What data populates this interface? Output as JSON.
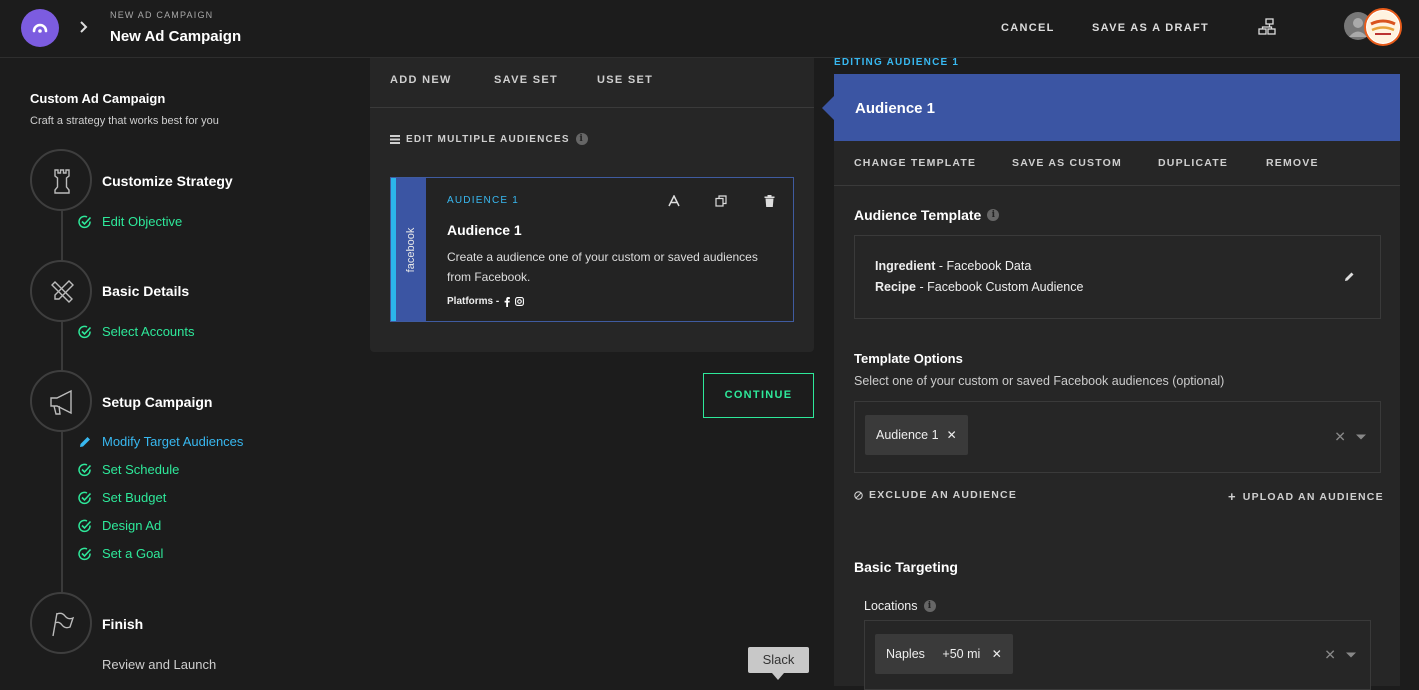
{
  "header": {
    "breadcrumb": "NEW AD CAMPAIGN",
    "title": "New Ad Campaign",
    "cancel_label": "CANCEL",
    "save_draft_label": "SAVE AS A DRAFT"
  },
  "sidebar": {
    "title": "Custom Ad Campaign",
    "subtitle": "Craft a strategy that works best for you",
    "steps": [
      {
        "title": "Customize Strategy",
        "icon": "rook-icon",
        "items": [
          {
            "label": "Edit Objective",
            "status": "done"
          }
        ]
      },
      {
        "title": "Basic Details",
        "icon": "tools-icon",
        "items": [
          {
            "label": "Select Accounts",
            "status": "done"
          }
        ]
      },
      {
        "title": "Setup Campaign",
        "icon": "megaphone-icon",
        "items": [
          {
            "label": "Modify Target Audiences",
            "status": "active"
          },
          {
            "label": "Set Schedule",
            "status": "done"
          },
          {
            "label": "Set Budget",
            "status": "done"
          },
          {
            "label": "Design Ad",
            "status": "done"
          },
          {
            "label": "Set a Goal",
            "status": "done"
          }
        ]
      },
      {
        "title": "Finish",
        "icon": "flag-icon",
        "items": [
          {
            "label": "Review and Launch",
            "status": "plain"
          }
        ]
      }
    ]
  },
  "audience_panel": {
    "tabs": [
      "ADD NEW",
      "SAVE SET",
      "USE SET"
    ],
    "edit_multiple_label": "EDIT MULTIPLE AUDIENCES",
    "card": {
      "network": "facebook",
      "tag": "AUDIENCE 1",
      "title": "Audience 1",
      "description": "Create a audience one of your custom or saved audiences from Facebook.",
      "platforms_label": "Platforms -"
    },
    "continue_label": "CONTINUE"
  },
  "tooltip": {
    "label": "Slack"
  },
  "editor": {
    "editing_label": "EDITING AUDIENCE 1",
    "title": "Audience 1",
    "actions": [
      "CHANGE TEMPLATE",
      "SAVE AS CUSTOM",
      "DUPLICATE",
      "REMOVE"
    ],
    "template_heading": "Audience Template",
    "ingredient_key": "Ingredient",
    "ingredient_value": " - Facebook Data",
    "recipe_key": "Recipe",
    "recipe_value": " - Facebook Custom Audience",
    "options_heading": "Template Options",
    "options_sub": "Select one of your custom or saved Facebook audiences (optional)",
    "selected_chip": "Audience 1",
    "exclude_label": "EXCLUDE AN AUDIENCE",
    "upload_label": "UPLOAD AN AUDIENCE",
    "basic_targeting_heading": "Basic Targeting",
    "locations_label": "Locations",
    "location_chip_city": "Naples",
    "location_chip_radius": "+50 mi"
  },
  "colors": {
    "accent_green": "#2ee89a",
    "accent_blue": "#38b8f0",
    "facebook_blue": "#3b55a3",
    "background": "#1c1c1c",
    "panel": "#262626"
  }
}
